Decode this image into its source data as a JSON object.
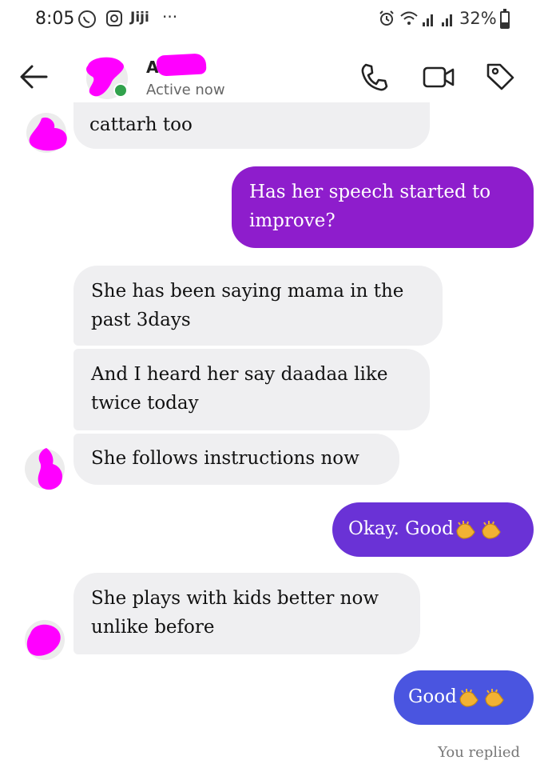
{
  "status_bar": {
    "time": "8:05",
    "app_label": "Jiji",
    "more": "···",
    "battery": "32%",
    "battery_level": 0.32
  },
  "header": {
    "name_visible": "A",
    "status": "Active now",
    "icons": [
      "back-arrow-icon",
      "phone-icon",
      "video-camera-icon",
      "tag-icon"
    ]
  },
  "messages": [
    {
      "side": "incoming",
      "text": "cattarh too"
    },
    {
      "side": "outgoing",
      "lines": [
        "Has her speech started to",
        "improve?"
      ],
      "color": "#8e1dcc"
    },
    {
      "side": "incoming",
      "lines": [
        "She has been saying mama in the",
        "past 3days"
      ]
    },
    {
      "side": "incoming",
      "lines": [
        "And I heard her say daadaa like",
        "twice today"
      ]
    },
    {
      "side": "incoming",
      "text": "She follows instructions now"
    },
    {
      "side": "outgoing",
      "text": "Okay. Good",
      "emoji": "clapping-hands-icon",
      "color": "#6a32d6"
    },
    {
      "side": "incoming",
      "lines": [
        "She plays with kids better now",
        "unlike before"
      ]
    },
    {
      "side": "outgoing",
      "text": "Good",
      "emoji": "clapping-hands-icon",
      "color": "#4a55e0"
    }
  ],
  "footer_caption": "You replied",
  "colors": {
    "incoming_bubble": "#efeff1",
    "redaction": "#ff00ff",
    "active_dot": "#31a24c"
  }
}
